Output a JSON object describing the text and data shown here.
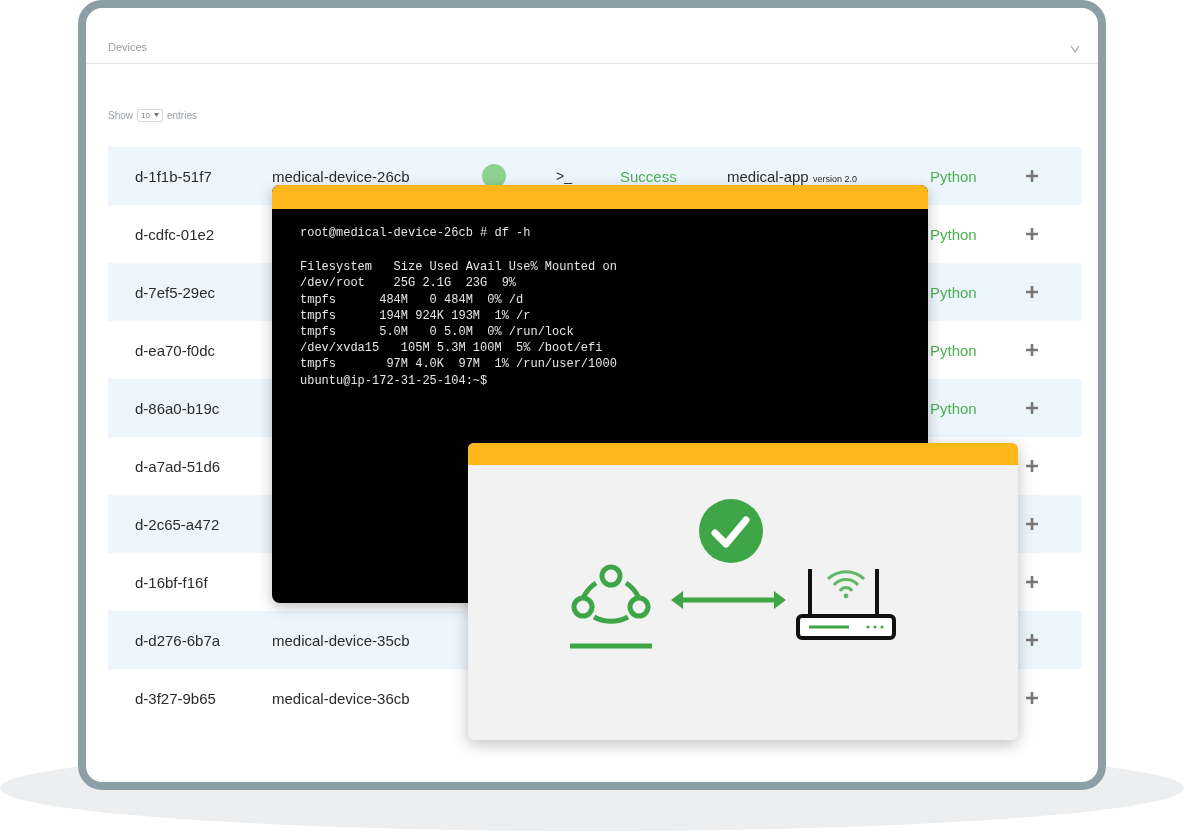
{
  "panel": {
    "title": "Devices"
  },
  "length_control": {
    "prefix": "Show",
    "value": "10",
    "suffix": "entries"
  },
  "rows": [
    {
      "id": "d-1f1b-51f7",
      "name": "medical-device-26cb",
      "online": true,
      "console": ">_",
      "result": "Success",
      "app": "medical-app",
      "app_version": "version 2.0",
      "runtime": "Python"
    },
    {
      "id": "d-cdfc-01e2",
      "runtime": "Python"
    },
    {
      "id": "d-7ef5-29ec",
      "runtime": "Python"
    },
    {
      "id": "d-ea70-f0dc",
      "runtime": "Python"
    },
    {
      "id": "d-86a0-b19c",
      "runtime": "Python"
    },
    {
      "id": "d-a7ad-51d6"
    },
    {
      "id": "d-2c65-a472"
    },
    {
      "id": "d-16bf-f16f"
    },
    {
      "id": "d-d276-6b7a",
      "name": "medical-device-35cb"
    },
    {
      "id": "d-3f27-9b65",
      "name": "medical-device-36cb"
    }
  ],
  "terminal": {
    "command": "root@medical-device-26cb # df -h",
    "output": [
      "Filesystem   Size Used Avail Use% Mounted on",
      "/dev/root    25G 2.1G  23G  9%",
      "tmpfs      484M   0 484M  0% /d",
      "tmpfs      194M 924K 193M  1% /r",
      "tmpfs      5.0M   0 5.0M  0% /run/lock",
      "/dev/xvda15   105M 5.3M 100M  5% /boot/efi",
      "tmpfs       97M 4.0K  97M  1% /run/user/1000",
      "ubuntu@ip-172-31-25-104:~$"
    ]
  }
}
